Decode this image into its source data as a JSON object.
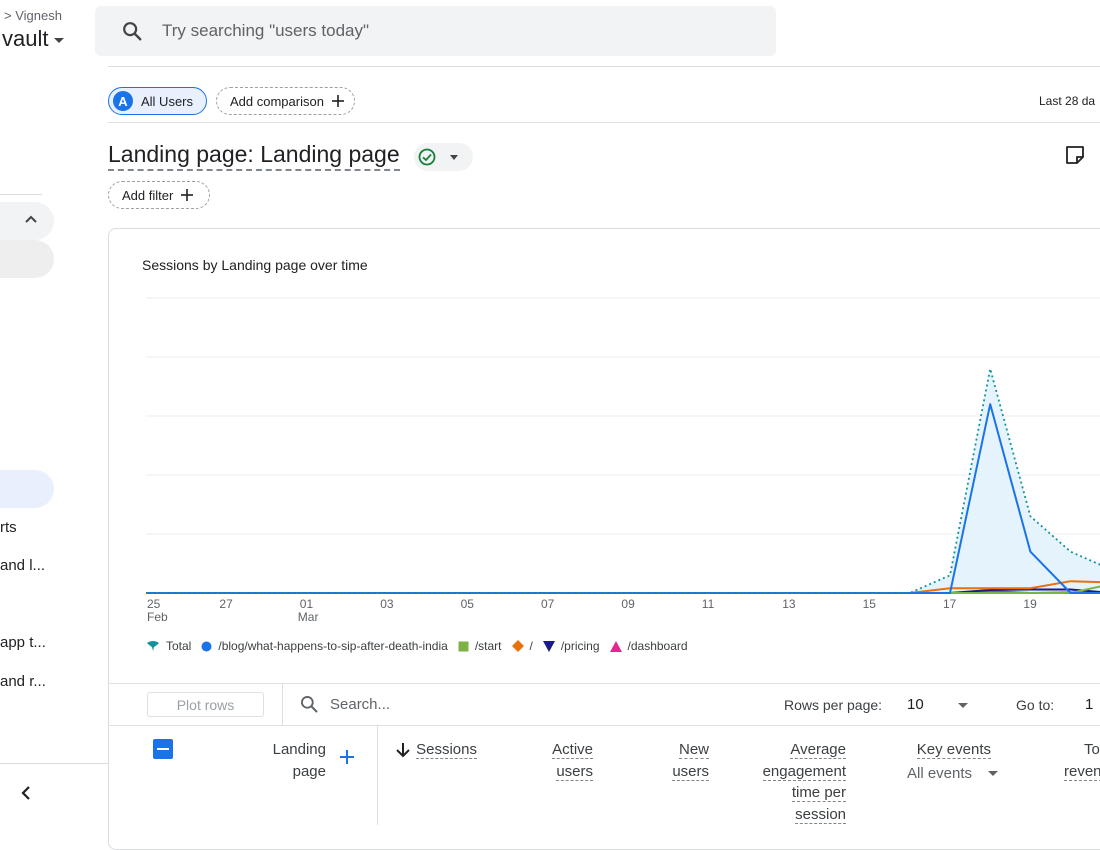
{
  "header": {
    "breadcrumb": "Vignesh",
    "property": "vault",
    "search_placeholder": "Try searching \"users today\""
  },
  "sidebar": {
    "items": [
      {
        "label": "rts"
      },
      {
        "label": "and l..."
      },
      {
        "label": "app t..."
      },
      {
        "label": "and r..."
      }
    ]
  },
  "comparison": {
    "segment_avatar": "A",
    "segment": "All Users",
    "add_comparison": "Add comparison",
    "date_range": "Last 28 da"
  },
  "report": {
    "title": "Landing page: Landing page",
    "add_filter": "Add filter"
  },
  "chart_data": {
    "type": "line",
    "title": "Sessions by Landing page over time",
    "x_ticks": [
      {
        "day": "25",
        "month": "Feb"
      },
      {
        "day": "27",
        "month": ""
      },
      {
        "day": "01",
        "month": "Mar"
      },
      {
        "day": "03",
        "month": ""
      },
      {
        "day": "05",
        "month": ""
      },
      {
        "day": "07",
        "month": ""
      },
      {
        "day": "09",
        "month": ""
      },
      {
        "day": "11",
        "month": ""
      },
      {
        "day": "13",
        "month": ""
      },
      {
        "day": "15",
        "month": ""
      },
      {
        "day": "17",
        "month": ""
      },
      {
        "day": "19",
        "month": ""
      }
    ],
    "x": [
      "Feb 25",
      "Feb 26",
      "Feb 27",
      "Feb 28",
      "Mar 01",
      "Mar 02",
      "Mar 03",
      "Mar 04",
      "Mar 05",
      "Mar 06",
      "Mar 07",
      "Mar 08",
      "Mar 09",
      "Mar 10",
      "Mar 11",
      "Mar 12",
      "Mar 13",
      "Mar 14",
      "Mar 15",
      "Mar 16",
      "Mar 17",
      "Mar 18",
      "Mar 19",
      "Mar 20",
      "Mar 21"
    ],
    "ylim": [
      0,
      50
    ],
    "grid": true,
    "legend_position": "bottom",
    "series": [
      {
        "name": "Total",
        "color": "#12939a",
        "style": "dotted-area",
        "values": [
          0,
          0,
          0,
          0,
          0,
          0,
          0,
          0,
          0,
          0,
          0,
          0,
          0,
          0,
          0,
          0,
          0,
          0,
          0,
          0,
          3,
          38,
          13,
          7,
          4
        ]
      },
      {
        "name": "/blog/what-happens-to-sip-after-death-india",
        "color": "#1a73e8",
        "values": [
          0,
          0,
          0,
          0,
          0,
          0,
          0,
          0,
          0,
          0,
          0,
          0,
          0,
          0,
          0,
          0,
          0,
          0,
          0,
          0,
          0,
          32,
          7,
          0,
          0
        ]
      },
      {
        "name": "/start",
        "color": "#7cb342",
        "values": [
          0,
          0,
          0,
          0,
          0,
          0,
          0,
          0,
          0,
          0,
          0,
          0,
          0,
          0,
          0,
          0,
          0,
          0,
          0,
          0,
          0,
          0,
          0,
          0,
          1.5
        ]
      },
      {
        "name": "/",
        "color": "#e8710a",
        "values": [
          0,
          0,
          0,
          0,
          0,
          0,
          0,
          0,
          0,
          0,
          0,
          0,
          0,
          0,
          0,
          0,
          0,
          0,
          0,
          0,
          0.8,
          0.8,
          0.8,
          2,
          1.8
        ]
      },
      {
        "name": "/pricing",
        "color": "#1a1a8c",
        "values": [
          0,
          0,
          0,
          0,
          0,
          0,
          0,
          0,
          0,
          0,
          0,
          0,
          0,
          0,
          0,
          0,
          0,
          0,
          0,
          0,
          0,
          0.5,
          0.6,
          0.6,
          0
        ]
      },
      {
        "name": "/dashboard",
        "color": "#e52592",
        "values": [
          0,
          0,
          0,
          0,
          0,
          0,
          0,
          0,
          0,
          0,
          0,
          0,
          0,
          0,
          0,
          0,
          0,
          0,
          0,
          0,
          0,
          0.3,
          0,
          0.1,
          0
        ]
      }
    ]
  },
  "table": {
    "plot_rows": "Plot rows",
    "search_placeholder": "Search...",
    "rows_per_page_label": "Rows per page:",
    "rows_per_page": "10",
    "goto_label": "Go to:",
    "goto_value": "1",
    "columns": {
      "landing": [
        "Landing",
        "page"
      ],
      "sessions": "Sessions",
      "active": [
        "Active",
        "users"
      ],
      "new": [
        "New",
        "users"
      ],
      "engagement": [
        "Average",
        "engagement",
        "time per",
        "session"
      ],
      "key_events": "Key events",
      "key_events_filter": "All events",
      "revenue": [
        "To",
        "reven"
      ]
    }
  }
}
